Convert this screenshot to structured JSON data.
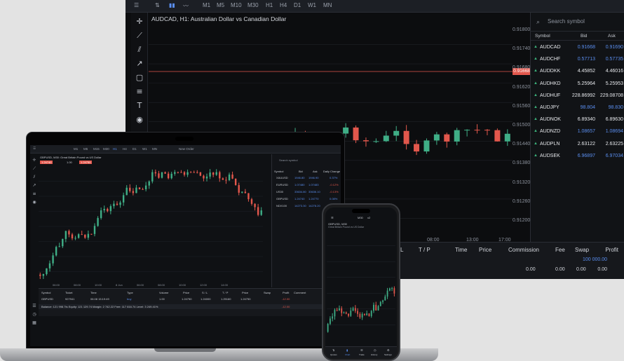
{
  "monitor": {
    "toolbar": {
      "timeframes": [
        "M1",
        "M5",
        "M10",
        "M30",
        "H1",
        "H4",
        "D1",
        "W1",
        "MN"
      ]
    },
    "chart_title": "AUDCAD, H1: Australian Dollar vs Canadian Dollar",
    "price_axis": [
      "0.91800",
      "0.91740",
      "0.91680",
      "0.91620",
      "0.91560",
      "0.91500",
      "0.91440",
      "0.91380",
      "0.91320",
      "0.91260",
      "0.91200"
    ],
    "current_price": "0.91668",
    "time_axis": [
      "08:00",
      "13:00",
      "17:00"
    ],
    "watchlist": {
      "search_placeholder": "Search symbol",
      "headers": {
        "symbol": "Symbol",
        "bid": "Bid",
        "ask": "Ask"
      },
      "rows": [
        {
          "symbol": "AUDCAD",
          "bid": "0.91668",
          "ask": "0.91690",
          "highlight": true
        },
        {
          "symbol": "AUDCHF",
          "bid": "0.57713",
          "ask": "0.57735",
          "highlight": true
        },
        {
          "symbol": "AUDDKK",
          "bid": "4.45852",
          "ask": "4.46016",
          "highlight": false
        },
        {
          "symbol": "AUDHKD",
          "bid": "5.25964",
          "ask": "5.25953",
          "highlight": false
        },
        {
          "symbol": "AUDHUF",
          "bid": "228.86992",
          "ask": "229.08708",
          "highlight": false
        },
        {
          "symbol": "AUDJPY",
          "bid": "98.804",
          "ask": "98.830",
          "highlight": true
        },
        {
          "symbol": "AUDNOK",
          "bid": "6.89340",
          "ask": "6.89630",
          "highlight": false
        },
        {
          "symbol": "AUDNZD",
          "bid": "1.08657",
          "ask": "1.08694",
          "highlight": true
        },
        {
          "symbol": "AUDPLN",
          "bid": "2.63122",
          "ask": "2.63225",
          "highlight": false
        },
        {
          "symbol": "AUDSEK",
          "bid": "6.96897",
          "ask": "6.97034",
          "highlight": true
        }
      ]
    },
    "positions": {
      "headers": {
        "sl": "L",
        "tp": "T / P",
        "time": "Time",
        "price": "Price",
        "commission": "Commission",
        "fee": "Fee",
        "swap": "Swap",
        "profit": "Profit"
      },
      "profit_value": "100 000.00",
      "totals": {
        "commission": "0.00",
        "fee": "0.00",
        "swap": "0.00",
        "profit": "0.00"
      }
    }
  },
  "laptop": {
    "toolbar": {
      "timeframes": [
        "M1",
        "M5",
        "M15",
        "M30",
        "H1",
        "H4",
        "D1",
        "W1",
        "MN"
      ],
      "new_order": "New Order"
    },
    "chart_title": "GBPUSD, M30: Great Britain Pound vs US Dollar",
    "sell_price": "1.24740",
    "buy_price": "1.24750",
    "lot": "1.00",
    "watchlist": {
      "search_placeholder": "Search symbol",
      "headers": {
        "symbol": "Symbol",
        "bid": "Bid",
        "ask": "Ask",
        "change": "Daily Change"
      },
      "rows": [
        {
          "symbol": "XAUUSD",
          "bid": "1946.80",
          "ask": "1946.90",
          "change": "0.37%"
        },
        {
          "symbol": "EURUSD",
          "bid": "1.07480",
          "ask": "1.07483",
          "change": "-0.12%"
        },
        {
          "symbol": "US30",
          "bid": "33634.80",
          "ask": "33636.10",
          "change": "-0.13%"
        },
        {
          "symbol": "GBPUSD",
          "bid": "1.24740",
          "ask": "1.24770",
          "change": "0.08%"
        },
        {
          "symbol": "NDX100",
          "bid": "14273.30",
          "ask": "14278.20",
          "change": "0.21%"
        }
      ]
    },
    "positions": {
      "headers": {
        "symbol": "Symbol",
        "ticket": "Ticket",
        "time": "Time",
        "type": "Type",
        "volume": "Volume",
        "price": "Price",
        "sl": "S / L",
        "tp": "T / P",
        "cprice": "Price",
        "swap": "Swap",
        "profit": "Profit",
        "comment": "Comment"
      },
      "row": {
        "symbol": "GBPUSD",
        "ticket": "927941",
        "time": "06.08 15:19:49",
        "type": "buy",
        "volume": "1.00",
        "price": "1.24750",
        "sl": "1.24000",
        "tp": "1.25160",
        "cprice": "1.24750",
        "swap": "",
        "profit": "-12.00"
      },
      "balance_line": "Balance: 121 998.7ts Equity: 121 129.74 Margin: 2 742.22 Free: 117 816.74 Level: 3 249.41%",
      "balance_profit": "-12.00"
    },
    "time_axis": [
      "06:00",
      "08:00",
      "10:00",
      "8 Jun",
      "06:00",
      "08:00",
      "10:00",
      "12:00",
      "14:00"
    ]
  },
  "phone": {
    "chart_title": "GBPUSD, M30",
    "subtitle": "Great Britain Pound vs US Dollar",
    "toolbar": [
      "M30",
      "x2"
    ],
    "nav": [
      "Quotes",
      "Chart",
      "Trade",
      "History",
      "Settings"
    ]
  },
  "colors": {
    "bull": "#3fae86",
    "bear": "#e2574c",
    "accent": "#5a8eef",
    "grid": "#1f2228"
  }
}
